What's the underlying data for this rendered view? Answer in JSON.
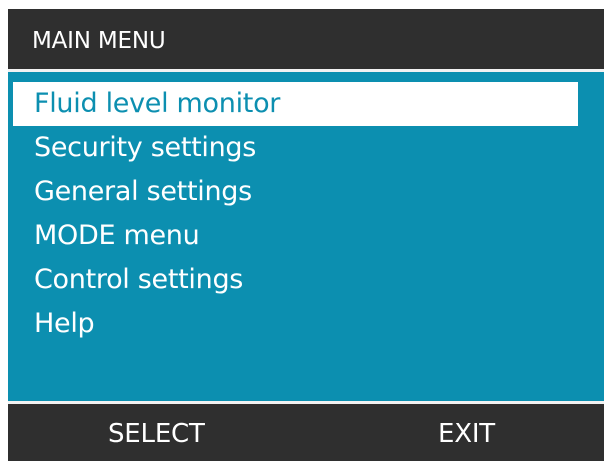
{
  "header": {
    "title": "MAIN MENU"
  },
  "menu": {
    "selected_index": 0,
    "items": [
      {
        "label": "Fluid level monitor"
      },
      {
        "label": "Security settings"
      },
      {
        "label": "General settings"
      },
      {
        "label": "MODE menu"
      },
      {
        "label": "Control settings"
      },
      {
        "label": "Help"
      }
    ]
  },
  "softkeys": {
    "left": "SELECT",
    "right": "EXIT"
  },
  "colors": {
    "background_dark": "#2f2f2f",
    "menu_background": "#0c8fb0",
    "highlight_background": "#ffffff",
    "highlight_text": "#0c8fb0",
    "text": "#ffffff"
  }
}
